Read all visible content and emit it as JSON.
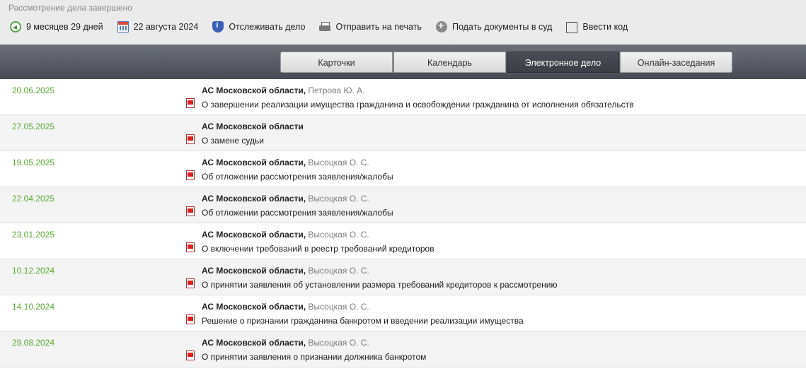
{
  "status": "Рассмотрение дела завершено",
  "toolbar": {
    "duration": "9 месяцев 29 дней",
    "date": "22 августа 2024",
    "track": "Отслеживать дело",
    "print": "Отправить на печать",
    "submit": "Подать документы в суд",
    "code": "Ввести код"
  },
  "tabs": [
    {
      "label": "Карточки"
    },
    {
      "label": "Календарь"
    },
    {
      "label": "Электронное дело",
      "active": true
    },
    {
      "label": "Онлайн-заседания"
    }
  ],
  "rows": [
    {
      "date": "20.06.2025",
      "court": "АС Московской области",
      "judge": "Петрова Ю. А.",
      "doc": "О завершении реализации имущества гражданина и освобождении гражданина от исполнения обязательств"
    },
    {
      "date": "27.05.2025",
      "court": "АС Московской области",
      "judge": "",
      "doc": "О замене судьи"
    },
    {
      "date": "19.05.2025",
      "court": "АС Московской области",
      "judge": "Высоцкая О. С.",
      "doc": "Об отложении рассмотрения заявления/жалобы"
    },
    {
      "date": "22.04.2025",
      "court": "АС Московской области",
      "judge": "Высоцкая О. С.",
      "doc": "Об отложении рассмотрения заявления/жалобы"
    },
    {
      "date": "23.01.2025",
      "court": "АС Московской области",
      "judge": "Высоцкая О. С.",
      "doc": "О включении требований в реестр требований кредиторов"
    },
    {
      "date": "10.12.2024",
      "court": "АС Московской области",
      "judge": "Высоцкая О. С.",
      "doc": "О принятии заявления об установлении размера требований кредиторов к рассмотрению"
    },
    {
      "date": "14.10.2024",
      "court": "АС Московской области",
      "judge": "Высоцкая О. С.",
      "doc": "Решение о признании гражданина банкротом и введении реализации имущества"
    },
    {
      "date": "29.08.2024",
      "court": "АС Московской области",
      "judge": "Высоцкая О. С.",
      "doc": "О принятии заявления о признании должника банкротом"
    }
  ]
}
